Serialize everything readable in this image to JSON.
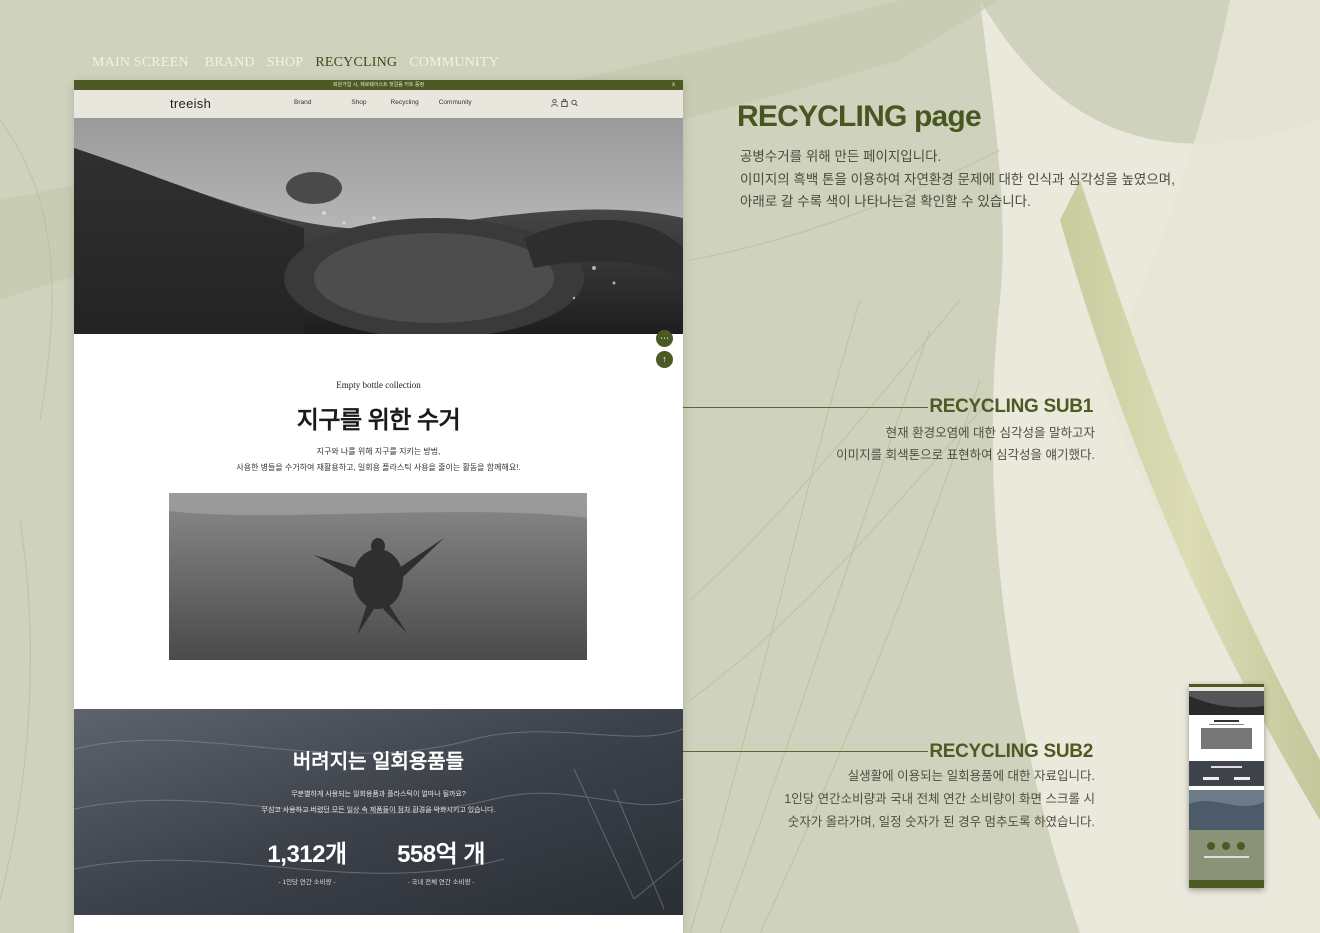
{
  "top_nav": {
    "items": [
      {
        "label": "MAIN SCREEN",
        "active": false
      },
      {
        "label": "BRAND",
        "active": false
      },
      {
        "label": "SHOP",
        "active": false
      },
      {
        "label": "RECYCLING",
        "active": true
      },
      {
        "label": "COMMUNITY",
        "active": false
      }
    ]
  },
  "mockup": {
    "promo_bar": {
      "text": "회원가입 시, 제로웨이스트 첫걸음 키트 증정",
      "close": "x"
    },
    "header": {
      "logo": "treeish",
      "menu": [
        "Brand",
        "Shop",
        "Recycling",
        "Community"
      ],
      "icons": [
        "user-icon",
        "bag-icon",
        "search-icon"
      ]
    },
    "floating_buttons": [
      "chat-icon",
      "arrow-up-icon"
    ],
    "section1": {
      "eyebrow": "Empty bottle collection",
      "title": "지구를 위한 수거",
      "desc_line1": "지구와 나를 위해 지구를 지키는 방법,",
      "desc_line2": "사용한 병들을 수거하여 재활용하고, 일회용 플라스틱 사용을 줄이는 활동을 함께해요!."
    },
    "section2": {
      "title": "버려지는 일회용품들",
      "desc_line1": "무분별하게 사용되는 일회용품과 플라스틱이 얼마나 될까요?",
      "desc_line2": "무심코 사용하고 버렸던 모든 일상 속 제품들이 점차 환경을 악화시키고 있습니다.",
      "stats": [
        {
          "value": "1,312개",
          "caption": "- 1인당 연간 소비량 -"
        },
        {
          "value": "558억 개",
          "caption": "- 국내 전체 연간 소비량 -"
        }
      ]
    }
  },
  "annotations": {
    "page_title": "RECYCLING page",
    "page_desc": [
      "공병수거를 위해 만든 페이지입니다.",
      "이미지의 흑백 톤을 이용하여 자연환경 문제에 대한 인식과 심각성을 높였으며,",
      "아래로 갈 수록 색이 나타나는걸 확인할 수 있습니다."
    ],
    "sub1": {
      "title": "RECYCLING SUB1",
      "desc": [
        "현재 환경오염에 대한 심각성을 말하고자",
        "이미지를 회색톤으로 표현하여 심각성을 얘기했다."
      ]
    },
    "sub2": {
      "title": "RECYCLING SUB2",
      "desc": [
        "실생활에 이용되는 일회용품에 대한 자료입니다.",
        "1인당 연간소비량과 국내 전체 연간 소비량이 화면 스크롤 시",
        "숫자가 올라가며, 일정 숫자가 된 경우 멈추도록 하였습니다."
      ]
    }
  },
  "colors": {
    "accent": "#4a5622",
    "promo_bar": "#4e5a24",
    "background": "#d8dac6"
  }
}
